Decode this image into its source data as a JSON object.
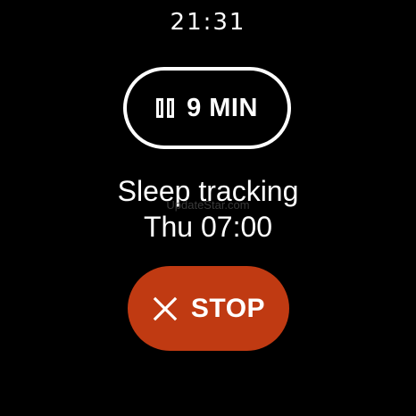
{
  "status_bar": {
    "time": "21:31"
  },
  "snooze_button": {
    "icon": "pause-icon",
    "label": "9 MIN"
  },
  "alarm": {
    "title": "Sleep tracking",
    "time": "Thu 07:00"
  },
  "watermark": "UpdateStar.com",
  "stop_button": {
    "icon": "close-icon",
    "label": "STOP",
    "color": "#c03a12"
  },
  "colors": {
    "background": "#000000",
    "text": "#ffffff"
  }
}
